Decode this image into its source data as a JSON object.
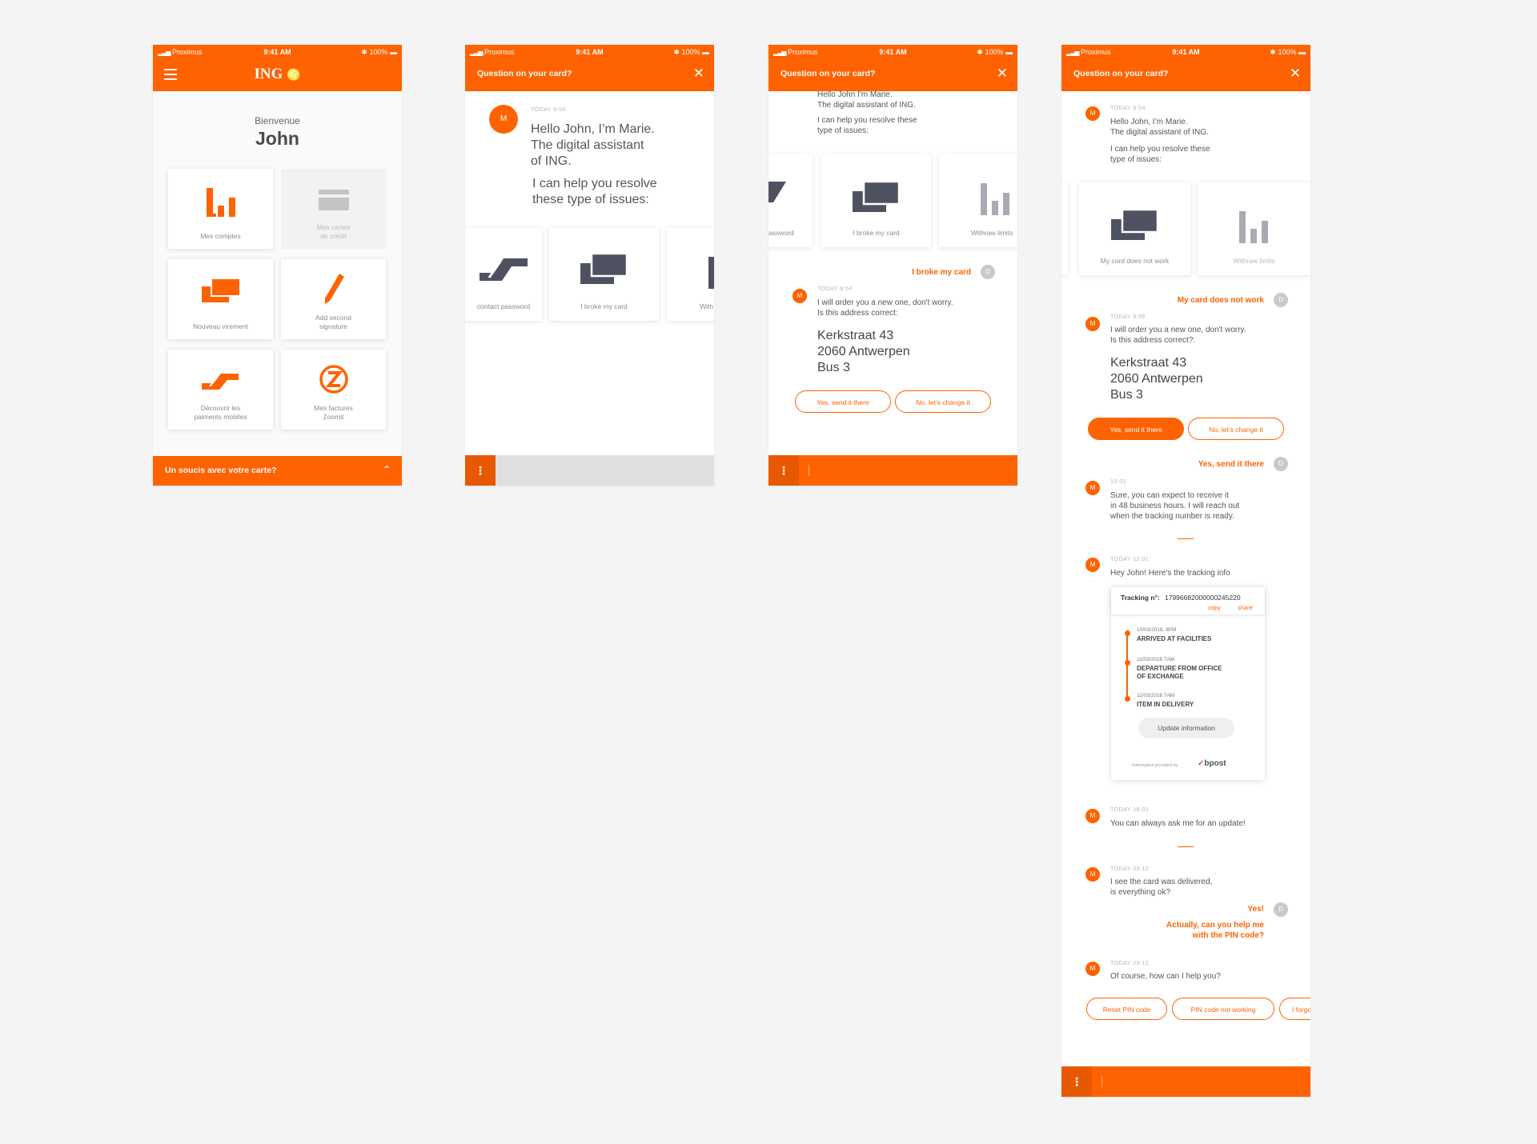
{
  "status_bar": {
    "carrier": "Proximus",
    "time": "9:41 AM",
    "battery": "100%"
  },
  "colors": {
    "brand": "#ff6200",
    "page_bg": "#f4f4f4",
    "disabled": "#b9b9b9"
  },
  "screen1": {
    "logo": "ING",
    "welcome": "Bienvenue",
    "user_name": "John",
    "tiles": [
      {
        "label": "Mes comptes",
        "icon": "bar-chart-icon"
      },
      {
        "label": "Mes cartes\nde crédit",
        "icon": "credit-card-icon"
      },
      {
        "label": "Nouveau virement",
        "icon": "transfer-cards-icon"
      },
      {
        "label": "Add second\nsignature",
        "icon": "pencil-icon"
      },
      {
        "label": "Découvrir les\npaiments mobiles",
        "icon": "mobile-payment-icon"
      },
      {
        "label": "Mes factures\nZoomit",
        "icon": "zoomit-icon"
      }
    ],
    "bottom_bar": "Un soucis avec votre carte?"
  },
  "chat_title": "Question on your card?",
  "assistant_initial": "M",
  "user_initial": "D",
  "screen2": {
    "timestamp": "TODAY 9:54",
    "greeting": "Hello John, I’m Marie.\nThe digital assistant\nof ING.",
    "help": "I can help you resolve\nthese type of issues:",
    "cards": [
      "contact password",
      "I broke my card",
      "With"
    ]
  },
  "screen3": {
    "greeting": "Hello John I'm Marie.\nThe digital assistant of ING.",
    "help": "I can help you resolve these\ntype of issues:",
    "cards": [
      "assword",
      "I broke my card",
      "Withraw limits"
    ],
    "user_reply": "I broke my card",
    "timestamp": "TODAY 9:54",
    "reply": "I will order you a new one, don't worry.\nIs this address correct:",
    "address": "Kerkstraat 43\n2060 Antwerpen\nBus 3",
    "btn_yes": "Yes, send it there",
    "btn_no": "No, let’s change it"
  },
  "screen4": {
    "timestamp1": "TODAY 9:54",
    "greeting": "Hello John, I’m Marie.\nThe digital assistant of ING.",
    "help": "I can help you resolve these\ntype of issues:",
    "cards": [
      "My card does not work",
      "Withraw limits"
    ],
    "user_reply1": "My card does not work",
    "timestamp2": "TODAY 9:56",
    "reply1": "I will order you a new one, don't worry.\nIs this address correct?:",
    "address": "Kerkstraat 43\n2060 Antwerpen\nBus 3",
    "btn_yes": "Yes, send it there",
    "btn_no": "No, let’s change it",
    "user_reply2": "Yes, send it there",
    "timestamp3": "10:01",
    "reply2": "Sure, you can expect to receive it\nin 48 business hours. I will reach out\nwhen the tracking number is ready.",
    "timestamp4": "TODAY 12:01",
    "reply3": "Hey John! Here's the tracking info",
    "tracking_label": "Tracking n°:",
    "tracking_number": "17996682000000245220",
    "copy": "copy",
    "share": "share",
    "steps": [
      {
        "date": "10/03/2018, 8PM",
        "title": "ARRIVED AT FACILITIES"
      },
      {
        "date": "11/03/2018  7AM",
        "title": "DEPARTURE FROM OFFICE\nOF EXCHANGE"
      },
      {
        "date": "11/03/2018  7AM",
        "title": "ITEM IN DELIVERY"
      }
    ],
    "update_btn": "Update information",
    "provided_by": "Information provided by",
    "carrier_logo": "bpost",
    "timestamp5": "TODAY 18:01",
    "reply4": "You can always ask me for an update!",
    "timestamp6": "TODAY 09:12",
    "reply5": "I see the card was delivered,\nis everything ok?",
    "user_reply3": "Yes!",
    "user_reply4": "Actually, can you help me\nwith the PIN code?",
    "timestamp7": "TODAY 09:12",
    "reply6": "Of course, how can I help you?",
    "quick_replies": [
      "Reset PIN code",
      "PIN code not working",
      "I forgo"
    ]
  }
}
